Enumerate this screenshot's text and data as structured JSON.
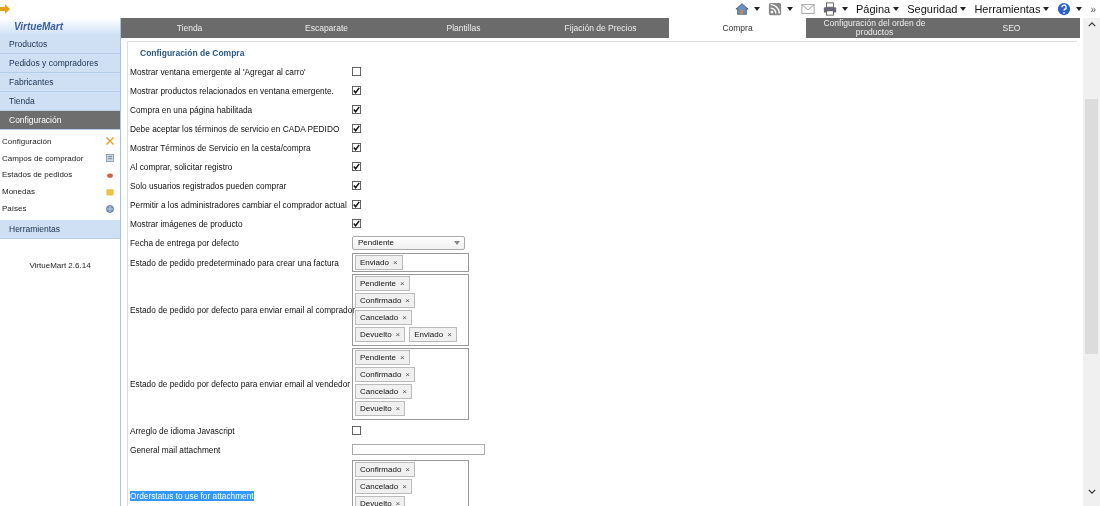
{
  "toolbar": {
    "items": [
      {
        "kind": "icon",
        "dropdown": true
      },
      {
        "kind": "icon",
        "dropdown": true
      },
      {
        "kind": "icon",
        "dropdown": false
      },
      {
        "kind": "icon",
        "dropdown": true
      },
      {
        "kind": "menu",
        "label": "Página"
      },
      {
        "kind": "menu",
        "label": "Seguridad"
      },
      {
        "kind": "menu",
        "label": "Herramientas"
      },
      {
        "kind": "icon",
        "dropdown": true
      }
    ],
    "overflow": "»"
  },
  "sidebar": {
    "logo": "VirtueMart",
    "items": [
      {
        "label": "Productos",
        "selected": false
      },
      {
        "label": "Pedidos y compradores",
        "selected": false
      },
      {
        "label": "Fabricantes",
        "selected": false
      },
      {
        "label": "Tienda",
        "selected": false
      },
      {
        "label": "Configuración",
        "selected": true,
        "children": [
          {
            "label": "Configuración"
          },
          {
            "label": "Campos de comprador"
          },
          {
            "label": "Estados de pedidos"
          },
          {
            "label": "Monedas"
          },
          {
            "label": "Países"
          }
        ]
      },
      {
        "label": "Herramientas",
        "selected": false
      }
    ],
    "version": "VirtueMart 2.6.14"
  },
  "tabs": [
    {
      "label": "Tienda",
      "selected": false
    },
    {
      "label": "Escaparate",
      "selected": false
    },
    {
      "label": "Plantillas",
      "selected": false
    },
    {
      "label": "Fijación de Precios",
      "selected": false
    },
    {
      "label": "Compra",
      "selected": true
    },
    {
      "label": "Configuración del orden de productos",
      "selected": false
    },
    {
      "label": "SEO",
      "selected": false
    }
  ],
  "section": {
    "legend": "Configuración de Compra",
    "rows": [
      {
        "kind": "checkbox",
        "label": "Mostrar ventana emergente al 'Agregar al carro'",
        "checked": false
      },
      {
        "kind": "checkbox",
        "label": "Mostrar productos relacionados en ventana emergente.",
        "checked": true
      },
      {
        "kind": "checkbox",
        "label": "Compra en una página habilitada",
        "checked": true
      },
      {
        "kind": "checkbox",
        "label": "Debe aceptar los términos de servicio en CADA PEDIDO",
        "checked": true
      },
      {
        "kind": "checkbox",
        "label": "Mostrar Términos de Servicio en la cesta/compra",
        "checked": true
      },
      {
        "kind": "checkbox",
        "label": "Al comprar, solicitar registro",
        "checked": true
      },
      {
        "kind": "checkbox",
        "label": "Solo usuarios registrados pueden comprar",
        "checked": true
      },
      {
        "kind": "checkbox",
        "label": "Permitir a los administradores cambiar el comprador actual",
        "checked": true
      },
      {
        "kind": "checkbox",
        "label": "Mostrar imágenes de producto",
        "checked": true
      },
      {
        "kind": "select",
        "label": "Fecha de entrega por defecto",
        "value": "Pendiente"
      },
      {
        "kind": "tags",
        "label": "Estado de pedido predeterminado para crear una factura",
        "tags": [
          "Enviado"
        ],
        "remove": "×"
      },
      {
        "kind": "tags",
        "label": "Estado de pedido por defecto para enviar email al comprador",
        "tags": [
          "Pendiente",
          "Confirmado",
          "Cancelado",
          "Devuelto",
          "Enviado"
        ],
        "remove": "×"
      },
      {
        "kind": "tags",
        "label": "Estado de pedido por defecto para enviar email al vendedor",
        "tags": [
          "Pendiente",
          "Confirmado",
          "Cancelado",
          "Devuelto"
        ],
        "remove": "×"
      },
      {
        "kind": "checkbox",
        "label": "Arreglo de idioma Javascript",
        "checked": false
      },
      {
        "kind": "text",
        "label": "General mail attachment"
      },
      {
        "kind": "tags",
        "label": "Orderstatus to use for attachment",
        "highlighted": true,
        "tags": [
          "Confirmado",
          "Cancelado",
          "Devuelto"
        ],
        "remove": "×"
      }
    ]
  }
}
